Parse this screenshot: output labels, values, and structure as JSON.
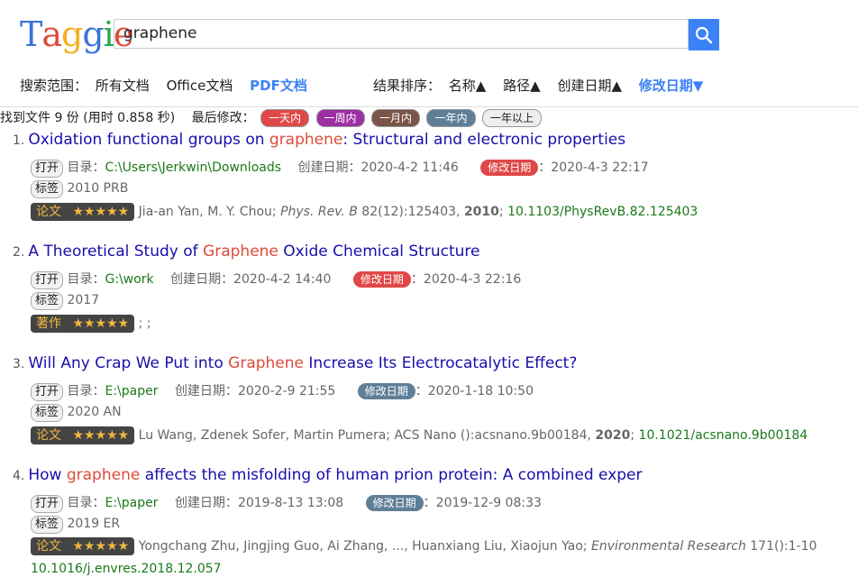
{
  "logo": [
    "T",
    "a",
    "g",
    "g",
    "i",
    "e"
  ],
  "logo_colors": [
    "#3b74d9",
    "#dd4b39",
    "#f2b01e",
    "#3b74d9",
    "#2aa952",
    "#dd4b39"
  ],
  "search": {
    "value": "graphene"
  },
  "scope": {
    "label": "搜索范围：",
    "options": [
      "所有文档",
      "Office文档",
      "PDF文档"
    ],
    "active": "PDF文档"
  },
  "sort": {
    "label": "结果排序：",
    "options": [
      "名称▲",
      "路径▲",
      "创建日期▲",
      "修改日期▼"
    ],
    "active": "修改日期▼"
  },
  "status": {
    "found": "找到文件 9 份 (用时 0.858 秒)",
    "last_mod_label": "最后修改：",
    "filters": [
      {
        "label": "一天内",
        "color": "#e04848"
      },
      {
        "label": "一周内",
        "color": "#9c2fa3"
      },
      {
        "label": "一月内",
        "color": "#7a5548"
      },
      {
        "label": "一年内",
        "color": "#5f7f98"
      },
      {
        "label": "一年以上",
        "color": "#eeeeee"
      }
    ]
  },
  "labels": {
    "open": "打开",
    "dir": "目录：",
    "created": "创建日期：",
    "modified": "修改日期",
    "tags": "标签",
    "colon": "："
  },
  "results": [
    {
      "num": "1.",
      "title_pre": "Oxidation functional groups on ",
      "title_hl": "graphene",
      "title_post": ": Structural and electronic properties",
      "dir": "C:\\Users\\Jerkwin\\Downloads",
      "created": "2020-4-2 11:46",
      "modified": "2020-4-3 22:17",
      "mod_color": "#e04848",
      "tags": "2010 PRB",
      "type": "论文",
      "stars": "★★★★★",
      "authors": "Jia-an Yan, M. Y. Chou; ",
      "journal": "Phys. Rev. B",
      "vol": " 82(12):125403, ",
      "year": "2010",
      "sep": "; ",
      "doi": "10.1103/PhysRevB.82.125403"
    },
    {
      "num": "2.",
      "title_pre": "A Theoretical Study of ",
      "title_hl": "Graphene",
      "title_post": " Oxide Chemical Structure",
      "dir": "G:\\work",
      "created": "2020-4-2 14:40",
      "modified": "2020-4-3 22:16",
      "mod_color": "#e04848",
      "tags": "2017",
      "type": "著作",
      "stars": "★★★★★",
      "authors": "; ;",
      "journal": "",
      "vol": "",
      "year": "",
      "sep": "",
      "doi": ""
    },
    {
      "num": "3.",
      "title_pre": "Will Any Crap We Put into ",
      "title_hl": "Graphene",
      "title_post": " Increase Its Electrocatalytic Effect?",
      "dir": "E:\\paper",
      "created": "2020-2-9 21:55",
      "modified": "2020-1-18 10:50",
      "mod_color": "#5f7f98",
      "tags": "2020 AN",
      "type": "论文",
      "stars": "★★★★★",
      "authors": "Lu Wang, Zdenek Sofer, Martin Pumera; ACS Nano ():acsnano.9b00184, ",
      "journal": "",
      "vol": "",
      "year": "2020",
      "sep": "; ",
      "doi": "10.1021/acsnano.9b00184"
    },
    {
      "num": "4.",
      "title_pre": "How ",
      "title_hl": "graphene",
      "title_post": " affects the misfolding of human prion protein: A combined exper",
      "dir": "E:\\paper",
      "created": "2019-8-13 13:08",
      "modified": "2019-12-9 08:33",
      "mod_color": "#5f7f98",
      "tags": "2019 ER",
      "type": "论文",
      "stars": "★★★★★",
      "authors": "Yongchang Zhu, Jingjing Guo, Ai Zhang, ..., Huanxiang Liu, Xiaojun Yao; ",
      "journal": "Environmental Research",
      "vol": " 171():1-10",
      "year": "",
      "sep": "",
      "doi": "10.1016/j.envres.2018.12.057"
    }
  ]
}
